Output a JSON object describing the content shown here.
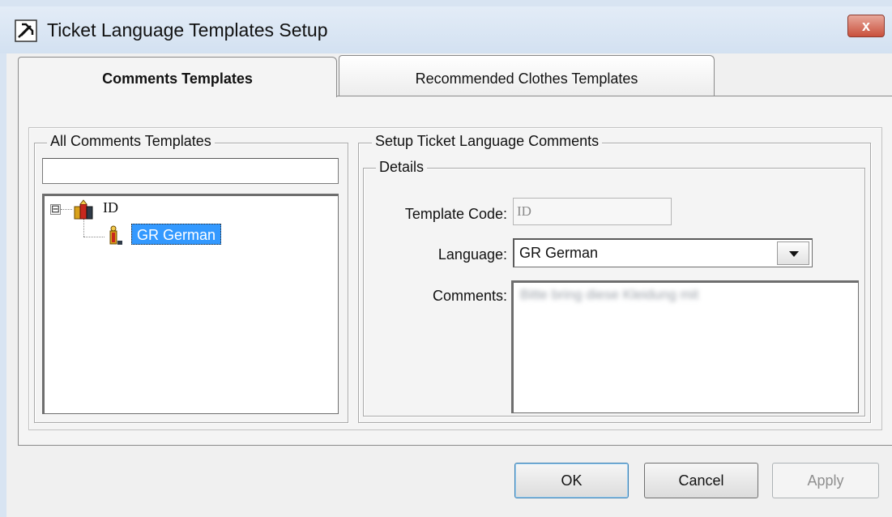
{
  "window": {
    "title": "Ticket Language Templates Setup",
    "close_label": "x",
    "icon": "app-tool-icon"
  },
  "tabs": [
    {
      "label": "Comments Templates",
      "selected": true
    },
    {
      "label": "Recommended Clothes Templates",
      "selected": false
    }
  ],
  "all_templates": {
    "legend": "All Comments Templates",
    "filter_value": "",
    "tree": {
      "root": {
        "label": "ID",
        "expander": "⊟",
        "icon": "template-folder-icon"
      },
      "children": [
        {
          "label": "GR German",
          "selected": true,
          "icon": "language-item-icon"
        }
      ]
    }
  },
  "setup": {
    "legend": "Setup Ticket Language Comments",
    "details_legend": "Details",
    "template_code_label": "Template Code:",
    "template_code_value": "ID",
    "language_label": "Language:",
    "language_value": "GR German",
    "comments_label": "Comments:",
    "comments_value": "Bitte bring diese Kleidung mit"
  },
  "buttons": {
    "ok": "OK",
    "cancel": "Cancel",
    "apply": "Apply"
  },
  "colors": {
    "selection": "#3399ff",
    "title_bar": "#d3e1f1",
    "close_button": "#c9503c",
    "dialog_bg": "#f0f0f0"
  }
}
